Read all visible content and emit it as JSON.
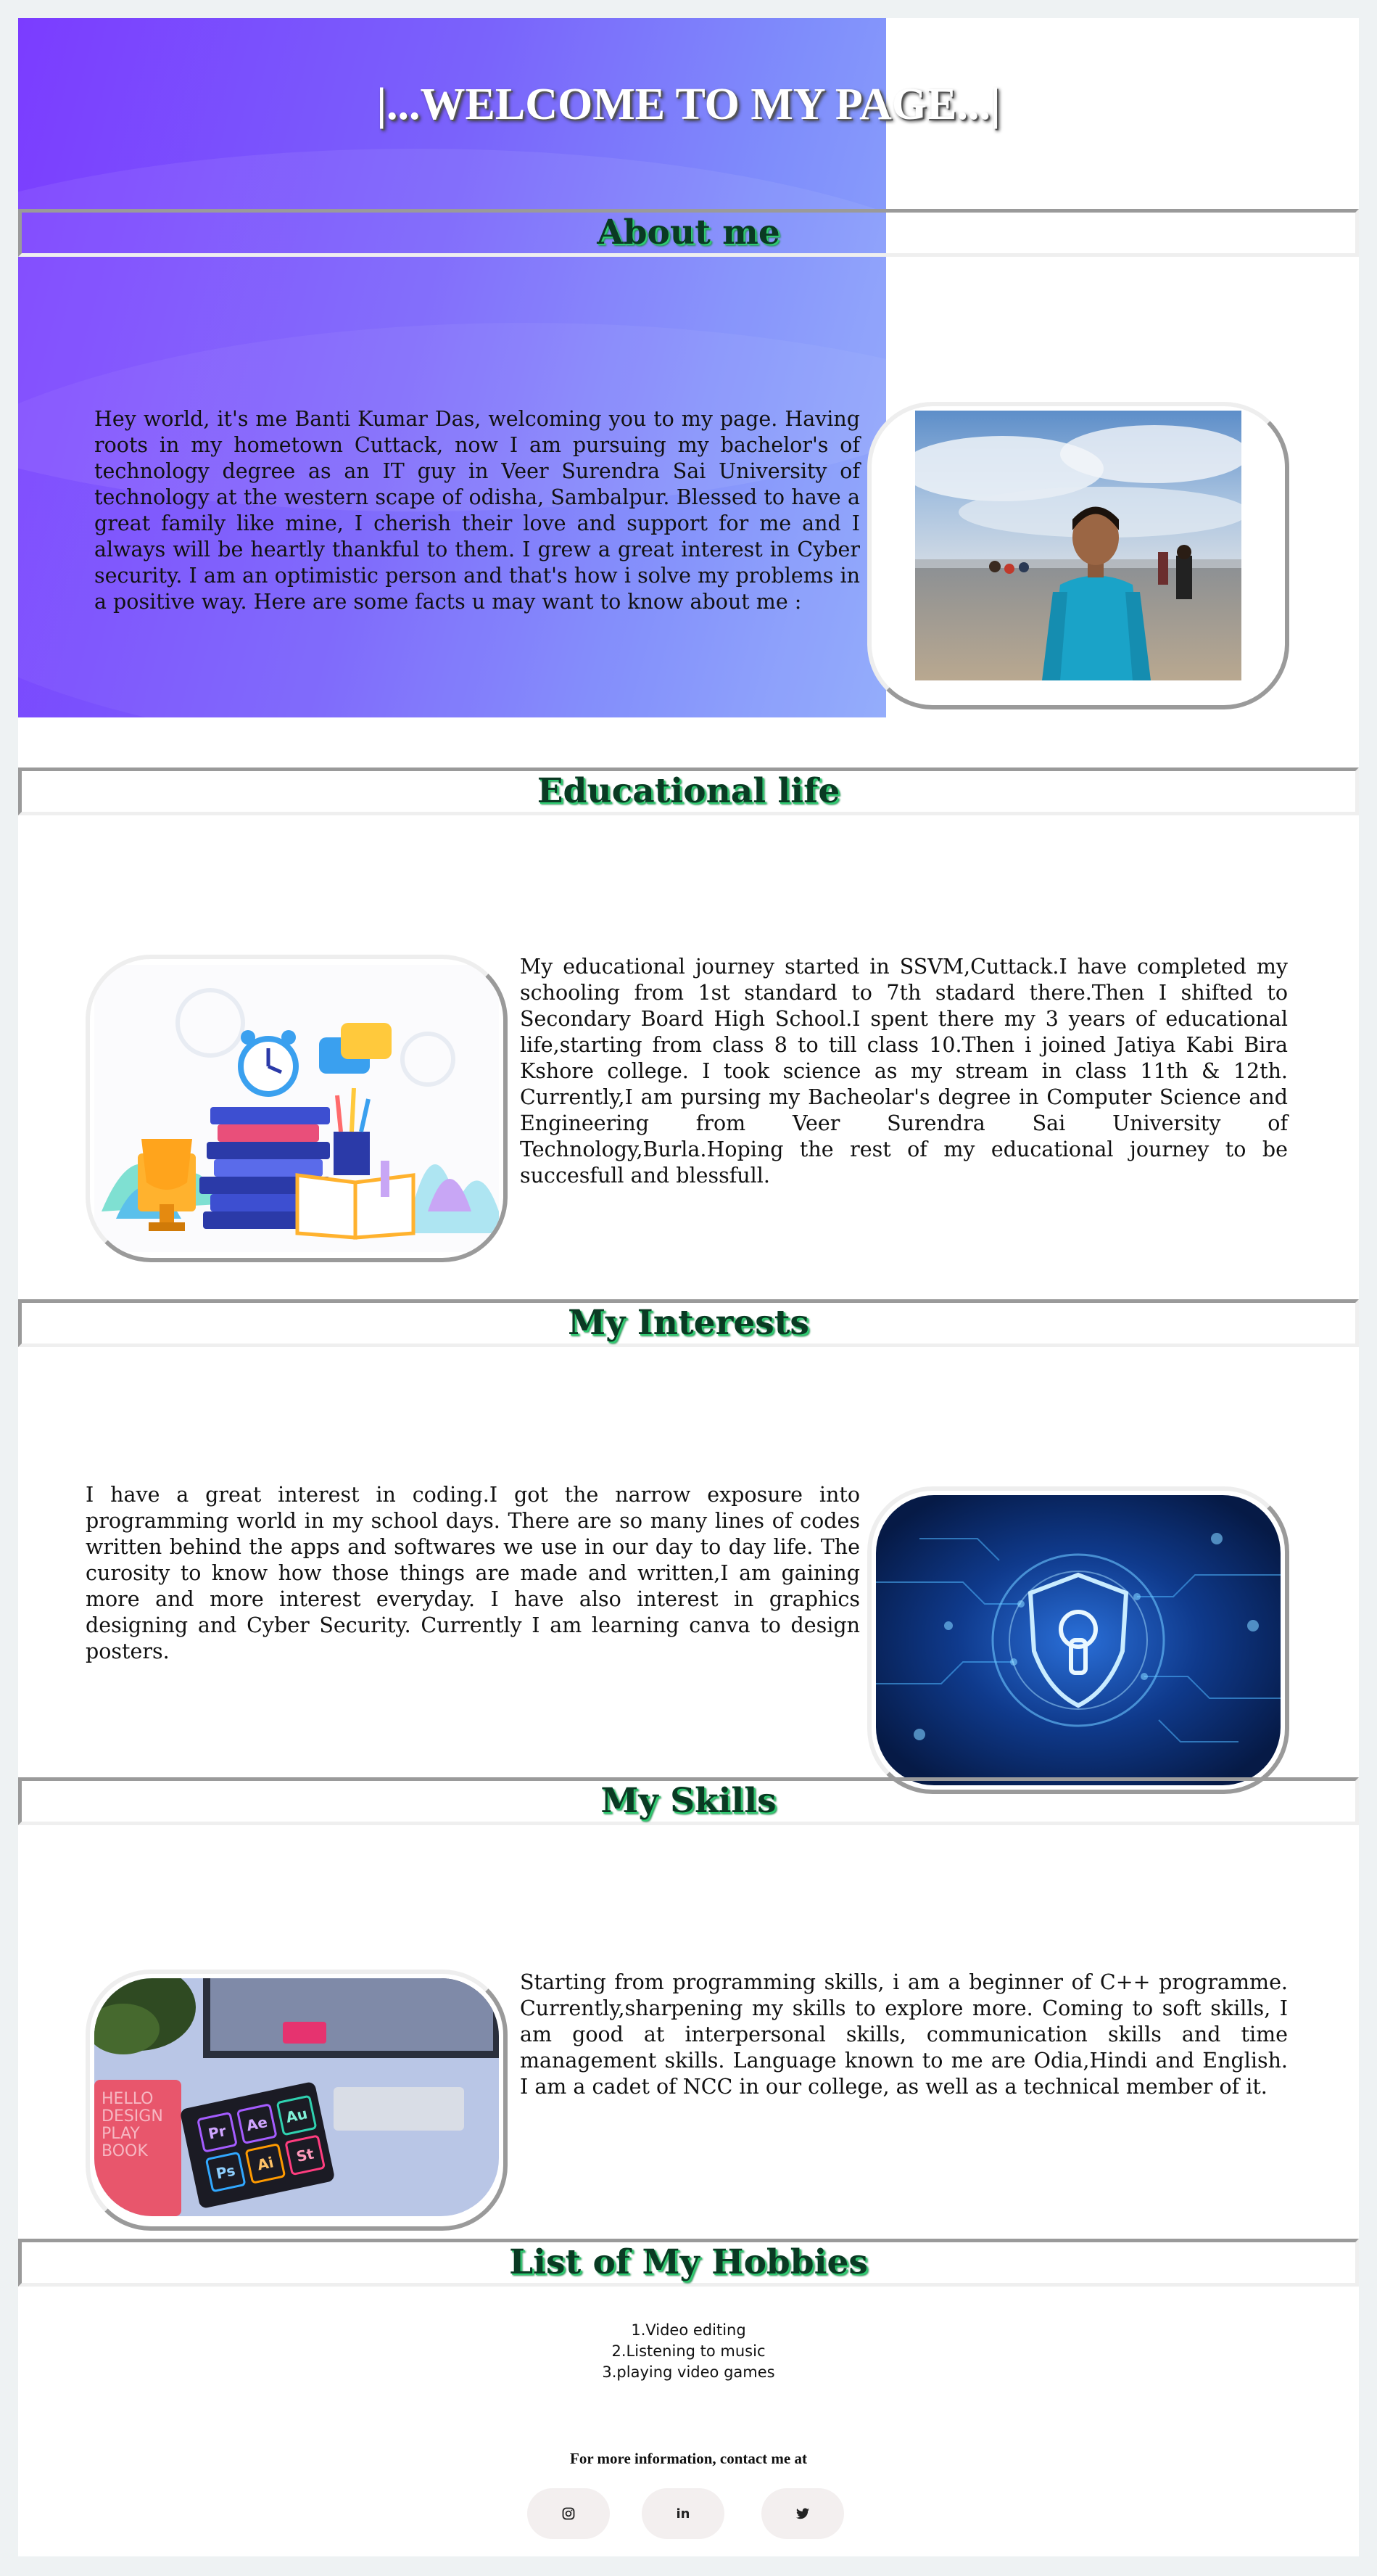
{
  "header": {
    "welcome": "|...WELCOME TO MY PAGE...|"
  },
  "about": {
    "title": "About me",
    "text": "Hey world, it's me Banti Kumar Das, welcoming you to my page. Having roots in my hometown Cuttack, now I am pursuing my bachelor's of technology degree as an IT guy in Veer Surendra Sai University of technology at the western scape of odisha, Sambalpur. Blessed to have a great family like mine, I cherish their love and support for me and I always will be heartly thankful to them. I grew a great interest in Cyber security. I am an optimistic person and that's how i solve my problems in a positive way. Here are some facts u may want to know about me :",
    "image_icon": "profile-photo"
  },
  "education": {
    "title": "Educational life",
    "text": "My educational journey started in SSVM,Cuttack.I have completed my schooling from 1st standard to 7th stadard there.Then I shifted to Secondary Board High School.I spent there my 3 years of educational life,starting from class 8 to till class 10.Then i joined Jatiya Kabi Bira Kshore college. I took science as my stream in class 11th & 12th. Currently,I am pursing my Bacheolar's degree in Computer Science and Engineering from Veer Surendra Sai University of Technology,Burla.Hoping the rest of my educational journey to be succesfull and blessfull.",
    "image_icon": "education-illustration"
  },
  "interests": {
    "title": "My Interests",
    "text": "I have a great interest in coding.I got the narrow exposure into programming world in my school days. There are so many lines of codes written behind the apps and softwares we use in our day to day life. The curosity to know how those things are made and written,I am gaining more and more interest everyday. I have also interest in graphics designing and Cyber Security. Currently I am learning canva to design posters.",
    "image_icon": "cyber-security-shield"
  },
  "skills": {
    "title": "My Skills",
    "text": "Starting from programming skills, i am a beginner of C++ programme. Currently,sharpening my skills to explore more. Coming to soft skills, I am good at interpersonal skills, communication skills and time management skills. Language known to me are Odia,Hindi and English. I am a cadet of NCC in our college, as well as a technical member of it.",
    "image_icon": "design-workspace",
    "notebook_text": [
      "HELLO",
      "DESIGN",
      "PLAY",
      "BOOK"
    ],
    "tiles": [
      "Pr",
      "Ae",
      "Au",
      "Ps",
      "Ai",
      "St"
    ]
  },
  "hobbies": {
    "title": "List of My Hobbies",
    "items": [
      "1.Video editing",
      "2.Listening to music",
      "3.playing video games"
    ]
  },
  "footer": {
    "contact": "For more information, contact me at",
    "social": [
      {
        "icon": "instagram-icon"
      },
      {
        "icon": "linkedin-icon",
        "glyph": "in"
      },
      {
        "icon": "twitter-icon"
      }
    ]
  },
  "colors": {
    "hero_gradient_start": "#7b3cff",
    "hero_gradient_end": "#8fa9fb",
    "heading_text": "#0a3a23",
    "heading_shadow": "#2ecc71",
    "page_bg": "#eef2f3"
  }
}
